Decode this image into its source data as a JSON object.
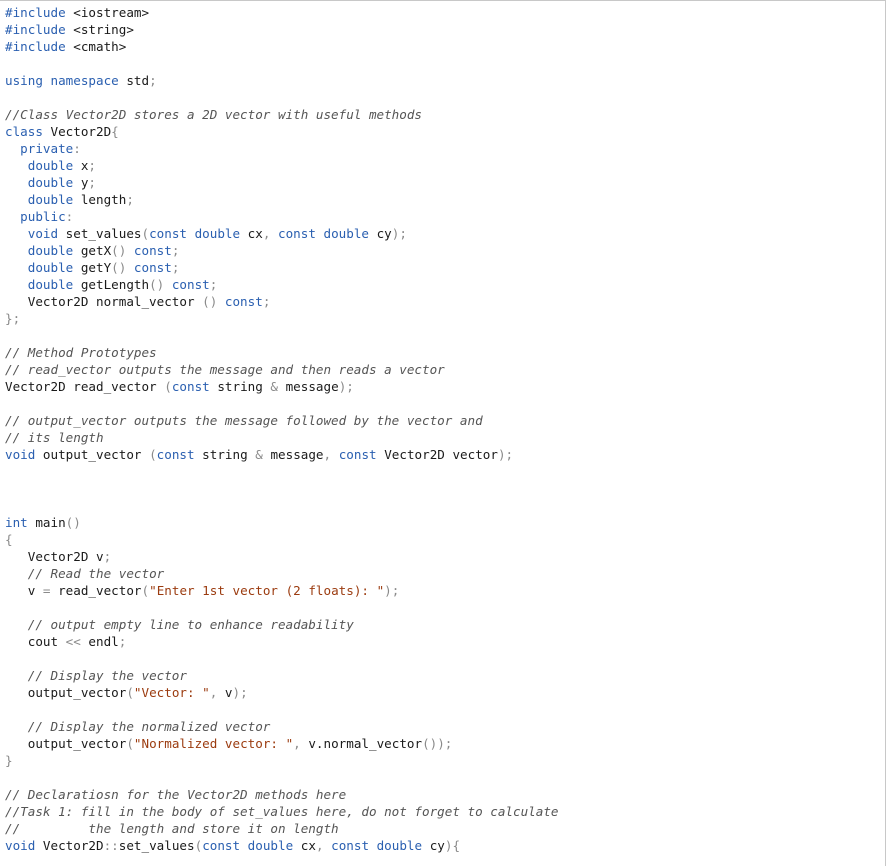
{
  "theme": {
    "keyword": "#2a5fb0",
    "string": "#9b3b0f",
    "comment": "#555555",
    "punctuation": "#8a8a8a",
    "text": "#1a1a1a"
  },
  "code_lines": [
    [
      [
        "kw",
        "#include"
      ],
      [
        "id",
        " <iostream>"
      ]
    ],
    [
      [
        "kw",
        "#include"
      ],
      [
        "id",
        " <string>"
      ]
    ],
    [
      [
        "kw",
        "#include"
      ],
      [
        "id",
        " <cmath>"
      ]
    ],
    [],
    [
      [
        "kw",
        "using namespace"
      ],
      [
        "id",
        " std"
      ],
      [
        "pun",
        ";"
      ]
    ],
    [],
    [
      [
        "com",
        "//Class Vector2D stores a 2D vector with useful methods"
      ]
    ],
    [
      [
        "kw",
        "class"
      ],
      [
        "id",
        " Vector2D"
      ],
      [
        "pun",
        "{"
      ]
    ],
    [
      [
        "id",
        "  "
      ],
      [
        "kw",
        "private"
      ],
      [
        "pun",
        ":"
      ]
    ],
    [
      [
        "id",
        "   "
      ],
      [
        "kw",
        "double"
      ],
      [
        "id",
        " x"
      ],
      [
        "pun",
        ";"
      ]
    ],
    [
      [
        "id",
        "   "
      ],
      [
        "kw",
        "double"
      ],
      [
        "id",
        " y"
      ],
      [
        "pun",
        ";"
      ]
    ],
    [
      [
        "id",
        "   "
      ],
      [
        "kw",
        "double"
      ],
      [
        "id",
        " length"
      ],
      [
        "pun",
        ";"
      ]
    ],
    [
      [
        "id",
        "  "
      ],
      [
        "kw",
        "public"
      ],
      [
        "pun",
        ":"
      ]
    ],
    [
      [
        "id",
        "   "
      ],
      [
        "kw",
        "void"
      ],
      [
        "id",
        " set_values"
      ],
      [
        "pun",
        "("
      ],
      [
        "kw",
        "const double"
      ],
      [
        "id",
        " cx"
      ],
      [
        "pun",
        ", "
      ],
      [
        "kw",
        "const double"
      ],
      [
        "id",
        " cy"
      ],
      [
        "pun",
        ");"
      ]
    ],
    [
      [
        "id",
        "   "
      ],
      [
        "kw",
        "double"
      ],
      [
        "id",
        " getX"
      ],
      [
        "pun",
        "() "
      ],
      [
        "kw",
        "const"
      ],
      [
        "pun",
        ";"
      ]
    ],
    [
      [
        "id",
        "   "
      ],
      [
        "kw",
        "double"
      ],
      [
        "id",
        " getY"
      ],
      [
        "pun",
        "() "
      ],
      [
        "kw",
        "const"
      ],
      [
        "pun",
        ";"
      ]
    ],
    [
      [
        "id",
        "   "
      ],
      [
        "kw",
        "double"
      ],
      [
        "id",
        " getLength"
      ],
      [
        "pun",
        "() "
      ],
      [
        "kw",
        "const"
      ],
      [
        "pun",
        ";"
      ]
    ],
    [
      [
        "id",
        "   Vector2D normal_vector "
      ],
      [
        "pun",
        "() "
      ],
      [
        "kw",
        "const"
      ],
      [
        "pun",
        ";"
      ]
    ],
    [
      [
        "pun",
        "};"
      ]
    ],
    [],
    [
      [
        "com",
        "// Method Prototypes"
      ]
    ],
    [
      [
        "com",
        "// read_vector outputs the message and then reads a vector"
      ]
    ],
    [
      [
        "id",
        "Vector2D read_vector "
      ],
      [
        "pun",
        "("
      ],
      [
        "kw",
        "const"
      ],
      [
        "id",
        " string "
      ],
      [
        "pun",
        "&"
      ],
      [
        "id",
        " message"
      ],
      [
        "pun",
        ");"
      ]
    ],
    [],
    [
      [
        "com",
        "// output_vector outputs the message followed by the vector and"
      ]
    ],
    [
      [
        "com",
        "// its length"
      ]
    ],
    [
      [
        "kw",
        "void"
      ],
      [
        "id",
        " output_vector "
      ],
      [
        "pun",
        "("
      ],
      [
        "kw",
        "const"
      ],
      [
        "id",
        " string "
      ],
      [
        "pun",
        "&"
      ],
      [
        "id",
        " message"
      ],
      [
        "pun",
        ", "
      ],
      [
        "kw",
        "const"
      ],
      [
        "id",
        " Vector2D vector"
      ],
      [
        "pun",
        ");"
      ]
    ],
    [],
    [],
    [],
    [
      [
        "kw",
        "int"
      ],
      [
        "id",
        " main"
      ],
      [
        "pun",
        "()"
      ]
    ],
    [
      [
        "pun",
        "{"
      ]
    ],
    [
      [
        "id",
        "   Vector2D v"
      ],
      [
        "pun",
        ";"
      ]
    ],
    [
      [
        "id",
        "   "
      ],
      [
        "com",
        "// Read the vector"
      ]
    ],
    [
      [
        "id",
        "   v "
      ],
      [
        "pun",
        "="
      ],
      [
        "id",
        " read_vector"
      ],
      [
        "pun",
        "("
      ],
      [
        "str",
        "\"Enter 1st vector (2 floats): \""
      ],
      [
        "pun",
        ");"
      ]
    ],
    [],
    [
      [
        "id",
        "   "
      ],
      [
        "com",
        "// output empty line to enhance readability"
      ]
    ],
    [
      [
        "id",
        "   cout "
      ],
      [
        "pun",
        "<<"
      ],
      [
        "id",
        " endl"
      ],
      [
        "pun",
        ";"
      ]
    ],
    [],
    [
      [
        "id",
        "   "
      ],
      [
        "com",
        "// Display the vector"
      ]
    ],
    [
      [
        "id",
        "   output_vector"
      ],
      [
        "pun",
        "("
      ],
      [
        "str",
        "\"Vector: \""
      ],
      [
        "pun",
        ", "
      ],
      [
        "id",
        "v"
      ],
      [
        "pun",
        ");"
      ]
    ],
    [],
    [
      [
        "id",
        "   "
      ],
      [
        "com",
        "// Display the normalized vector"
      ]
    ],
    [
      [
        "id",
        "   output_vector"
      ],
      [
        "pun",
        "("
      ],
      [
        "str",
        "\"Normalized vector: \""
      ],
      [
        "pun",
        ", "
      ],
      [
        "id",
        "v.normal_vector"
      ],
      [
        "pun",
        "());"
      ]
    ],
    [
      [
        "pun",
        "}"
      ]
    ],
    [],
    [
      [
        "com",
        "// Declaratiosn for the Vector2D methods here"
      ]
    ],
    [
      [
        "com",
        "//Task 1: fill in the body of set_values here, do not forget to calculate"
      ]
    ],
    [
      [
        "com",
        "//         the length and store it on length"
      ]
    ],
    [
      [
        "kw",
        "void"
      ],
      [
        "id",
        " Vector2D"
      ],
      [
        "pun",
        "::"
      ],
      [
        "id",
        "set_values"
      ],
      [
        "pun",
        "("
      ],
      [
        "kw",
        "const double"
      ],
      [
        "id",
        " cx"
      ],
      [
        "pun",
        ", "
      ],
      [
        "kw",
        "const double"
      ],
      [
        "id",
        " cy"
      ],
      [
        "pun",
        "){"
      ]
    ]
  ]
}
